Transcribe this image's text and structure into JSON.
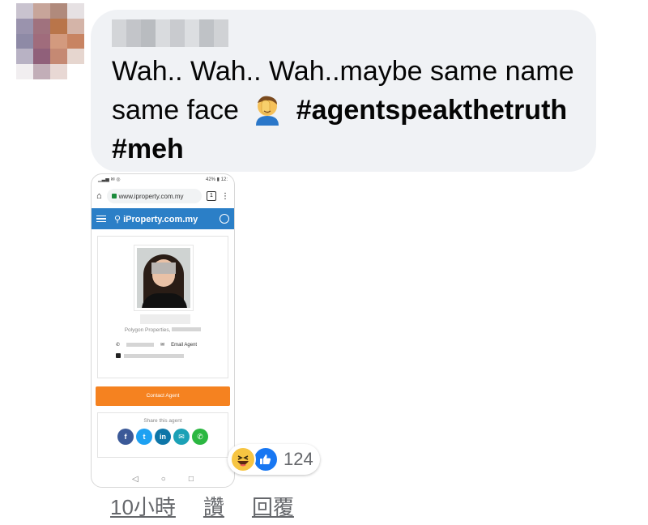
{
  "comment": {
    "text_plain": "Wah.. Wah.. Wah..maybe same name same face",
    "emoji": "facepalm-emoji",
    "hashtags": [
      "#agentspeakthetruth",
      "#meh"
    ]
  },
  "attachment": {
    "url": "www.iproperty.com.my",
    "tab_count": "1",
    "site_brand": "iProperty.com.my",
    "company": "Polygon Properties,",
    "email_label": "Email Agent",
    "cta_label": "Contact Agent",
    "share_label": "Share this agent",
    "share_buttons": [
      "facebook-icon",
      "twitter-icon",
      "linkedin-icon",
      "email-icon",
      "whatsapp-icon"
    ],
    "status_battery": "42%",
    "status_time": "12:"
  },
  "reactions": {
    "types": [
      "haha-icon",
      "like-icon"
    ],
    "count": "124"
  },
  "actions": {
    "time": "10小時",
    "like": "讚",
    "reply": "回覆"
  },
  "colors": {
    "bubble": "#f0f2f5",
    "site_blue": "#2b7fc7",
    "cta_orange": "#f58220",
    "like_blue": "#1877f2",
    "meta_grey": "#65676b"
  }
}
